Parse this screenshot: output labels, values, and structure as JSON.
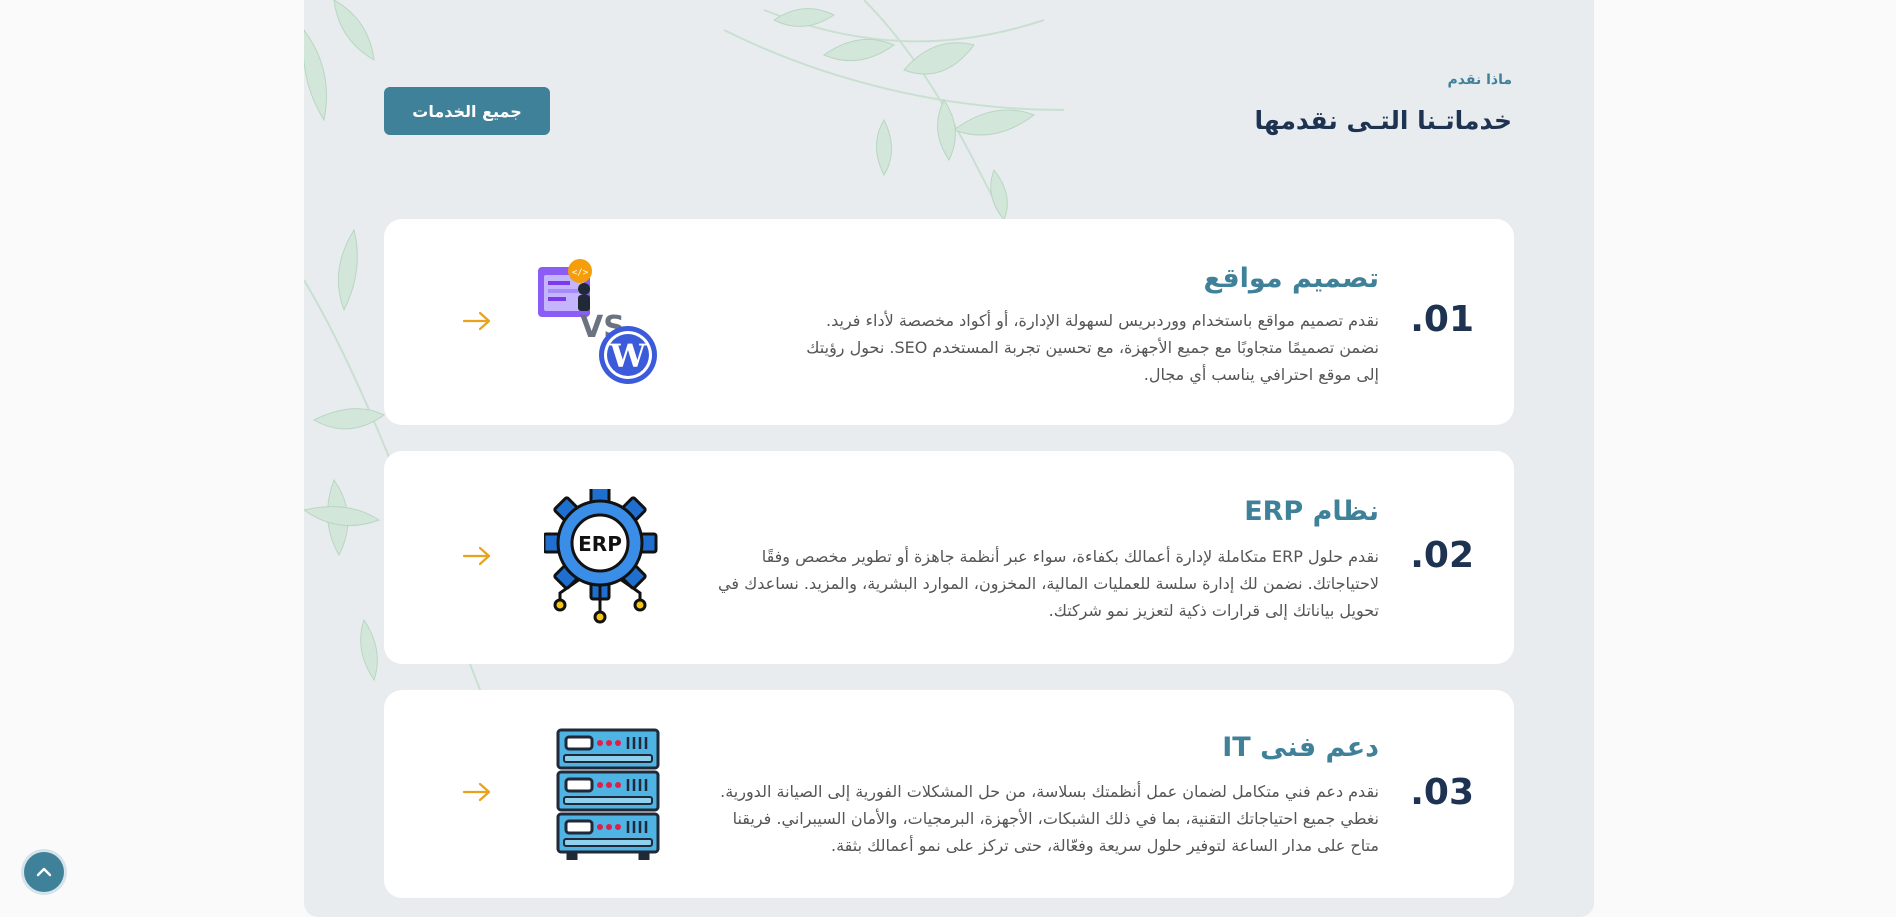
{
  "section": {
    "eyebrow": "ماذا نقدم",
    "title": "خدماتـنا التـى نقدمها",
    "all_services_label": "جميع الخدمات"
  },
  "services": [
    {
      "number": ".01",
      "title": "تصميم مواقع",
      "description": "نقدم تصميم مواقع باستخدام ووردبريس لسهولة الإدارة، أو أكواد مخصصة لأداء فريد. نضمن تصميمًا متجاوبًا مع جميع الأجهزة، مع تحسين تجربة المستخدم SEO. نحول رؤيتك إلى موقع احترافي يناسب أي مجال.",
      "icon": "web-design-vs-wordpress-icon",
      "icon_text": "VS"
    },
    {
      "number": ".02",
      "title": "نظام  ERP",
      "description": "نقدم حلول ERP متكاملة لإدارة أعمالك بكفاءة، سواء عبر أنظمة جاهزة أو تطوير مخصص وفقًا لاحتياجاتك. نضمن لك إدارة سلسة للعمليات المالية، المخزون، الموارد البشرية، والمزيد. نساعدك في تحويل بياناتك إلى قرارات ذكية لتعزيز نمو شركتك.",
      "icon": "erp-gear-icon",
      "icon_text": "ERP"
    },
    {
      "number": ".03",
      "title": "دعم فنى IT",
      "description": "نقدم دعم فني متكامل لضمان عمل أنظمتك بسلاسة، من حل المشكلات الفورية إلى الصيانة الدورية. نغطي جميع احتياجاتك التقنية، بما في ذلك الشبكات، الأجهزة، البرمجيات، والأمان السيبراني. فريقنا متاح على مدار الساعة لتوفير حلول سريعة وفعّالة، حتى تركز على نمو أعمالك بثقة.",
      "icon": "server-rack-icon"
    }
  ],
  "colors": {
    "accent": "#3f8199",
    "heading": "#1d3351",
    "arrow": "#e8a21c",
    "panel": "#e8ecef",
    "leaf": "#cfe3d6"
  }
}
